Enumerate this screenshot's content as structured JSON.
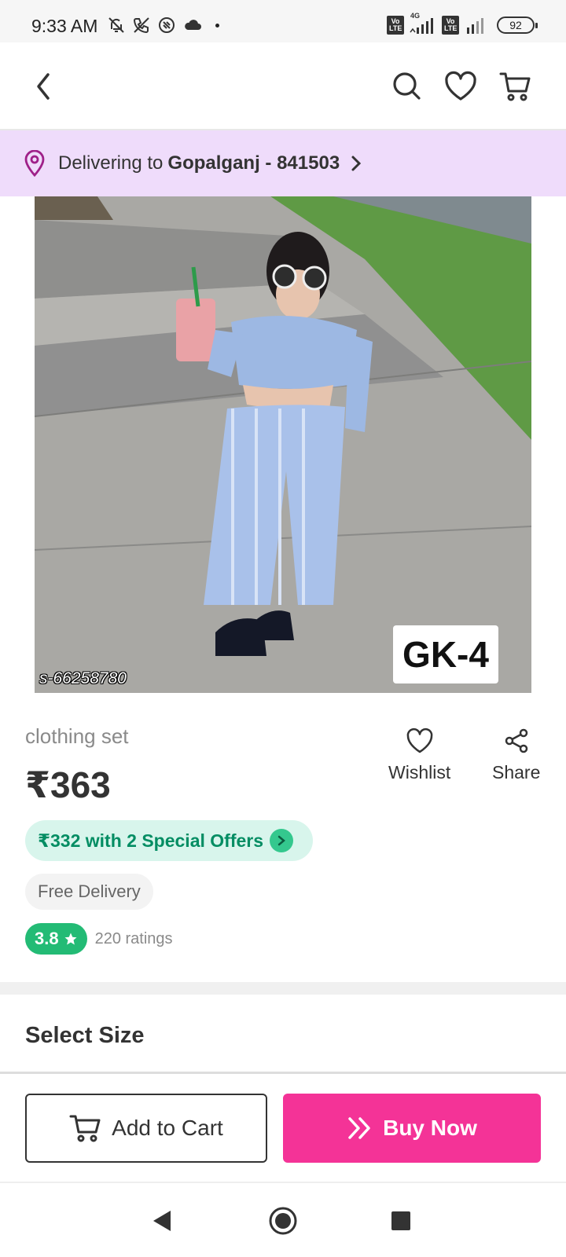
{
  "status_bar": {
    "time": "9:33 AM",
    "battery": "92",
    "network": "4G",
    "sim1_badge": "Vo LTE",
    "sim2_badge": "Vo LTE",
    "icons": [
      "bell-off-icon",
      "no-calls-icon",
      "screen-share-icon",
      "cloud-icon"
    ]
  },
  "top_nav": {
    "icons": [
      "back-arrow-icon",
      "search-icon",
      "heart-icon",
      "cart-icon"
    ]
  },
  "delivery": {
    "prefix": "Delivering to",
    "location": "Gopalganj - 841503",
    "icon": "location-pin-icon"
  },
  "product": {
    "image_code": "s-66258780",
    "image_tag": "GK-4",
    "name": "clothing set",
    "price": "₹363",
    "offer_text": "₹332 with 2 Special Offers",
    "free_delivery": "Free Delivery",
    "rating": "3.8",
    "rating_count": "220 ratings"
  },
  "actions": {
    "wishlist_label": "Wishlist",
    "share_label": "Share"
  },
  "select_size": {
    "title": "Select Size"
  },
  "cta": {
    "add_to_cart": "Add to Cart",
    "buy_now": "Buy Now"
  },
  "colors": {
    "brand_pink": "#f43397",
    "offer_green": "#038d63",
    "rating_green": "#23bb75",
    "delivery_bg": "#efdcfb",
    "location_icon": "#9f2089"
  }
}
